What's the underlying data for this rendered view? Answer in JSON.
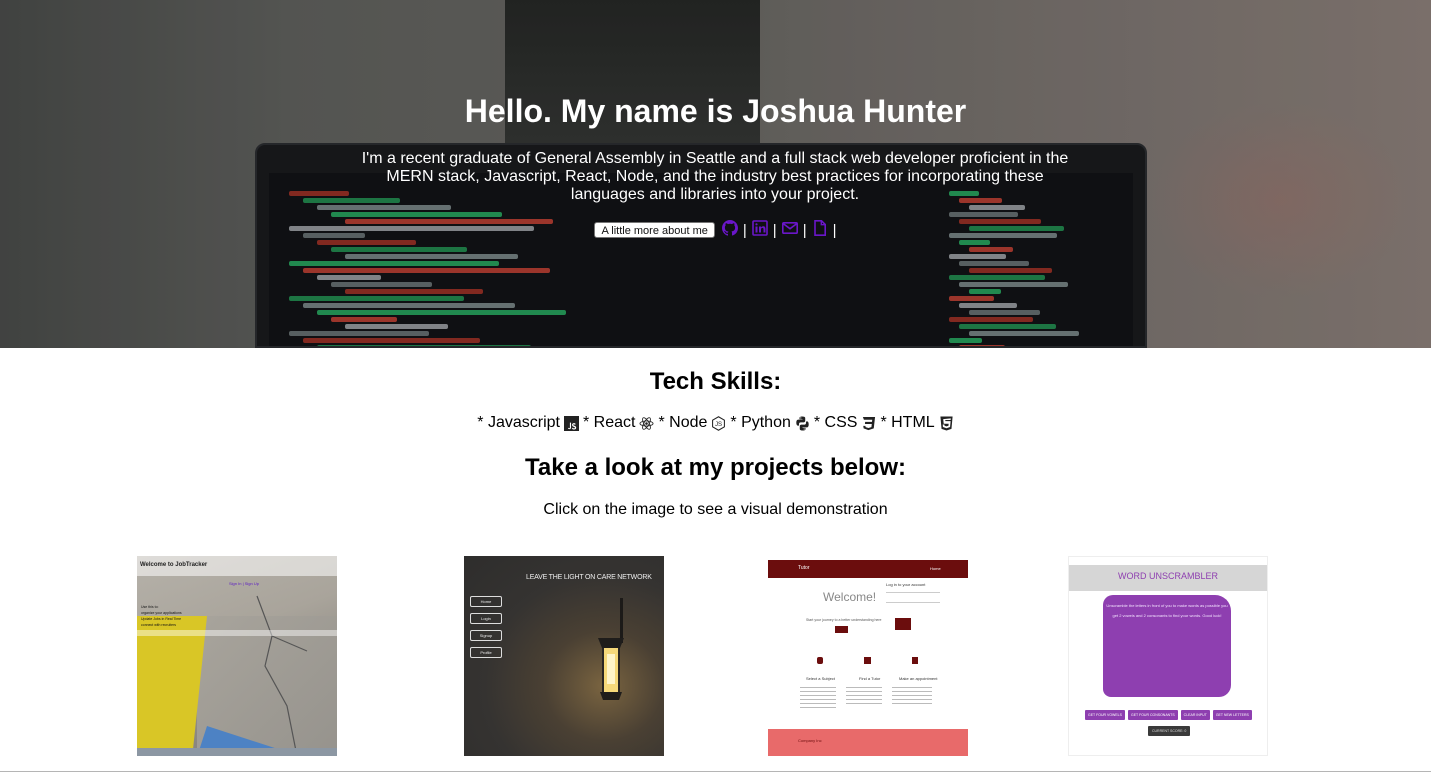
{
  "hero": {
    "title": "Hello. My name is Joshua Hunter",
    "intro": "I'm a recent graduate of General Assembly in Seattle and a full stack web developer proficient in the MERN stack, Javascript, React, Node, and the industry best practices for incorporating these languages and libraries into your project.",
    "about_button": "A little more about me",
    "separator": "|",
    "links": [
      {
        "icon": "github-icon",
        "color": "#6a16c9"
      },
      {
        "icon": "linkedin-icon",
        "color": "#6a16c9"
      },
      {
        "icon": "email-icon",
        "color": "#6a16c9"
      },
      {
        "icon": "resume-file-icon",
        "color": "#6a16c9"
      }
    ]
  },
  "skills": {
    "title": "Tech Skills:",
    "items": [
      {
        "label": "* Javascript",
        "icon": "javascript-icon"
      },
      {
        "label": "* React",
        "icon": "react-icon"
      },
      {
        "label": "* Node",
        "icon": "nodejs-icon"
      },
      {
        "label": "* Python",
        "icon": "python-icon"
      },
      {
        "label": "* CSS",
        "icon": "css3-icon"
      },
      {
        "label": "* HTML",
        "icon": "html5-icon"
      }
    ]
  },
  "projects": {
    "title": "Take a look at my projects below:",
    "subtitle": "Click on the image to see a visual demonstration",
    "thumbnails": [
      {
        "heading": "Welcome to JobTracker",
        "link": "Sign In | Sign Up",
        "lines": [
          "Use this to:",
          "organize your applications",
          "Update Jobs in Real Time",
          "connect with recruiters"
        ]
      },
      {
        "heading": "LEAVE THE LIGHT ON CARE NETWORK",
        "menu": [
          "Home",
          "Login",
          "Signup",
          "Profile"
        ]
      },
      {
        "brand": "Tutor",
        "nav": "Home",
        "welcome": "Welcome!",
        "tagline": "Start your journey to a better understanding here",
        "login_title": "Log in to your account",
        "features": [
          "Select a Subject",
          "Find a Tutor",
          "Make an appointment"
        ],
        "footer": "Company Inc"
      },
      {
        "title": "WORD UNSCRAMBLER",
        "instructions": "Unscramble the letters in front of you to make words as possible you get 2 vowels and 2 consonants to find your words. Good luck!",
        "buttons": [
          "GET FOUR VOWELS",
          "GET FOUR CONSONANTS",
          "CLEAR INPUT",
          "GET NEW LETTERS"
        ],
        "score_button": "CURRENT SCORE: 0"
      }
    ]
  },
  "colors": {
    "link_purple": "#6a16c9",
    "tutor_maroon": "#6b0d0d",
    "tutor_coral": "#e86a6a",
    "unscrambler_purple": "#8e3fb0"
  }
}
